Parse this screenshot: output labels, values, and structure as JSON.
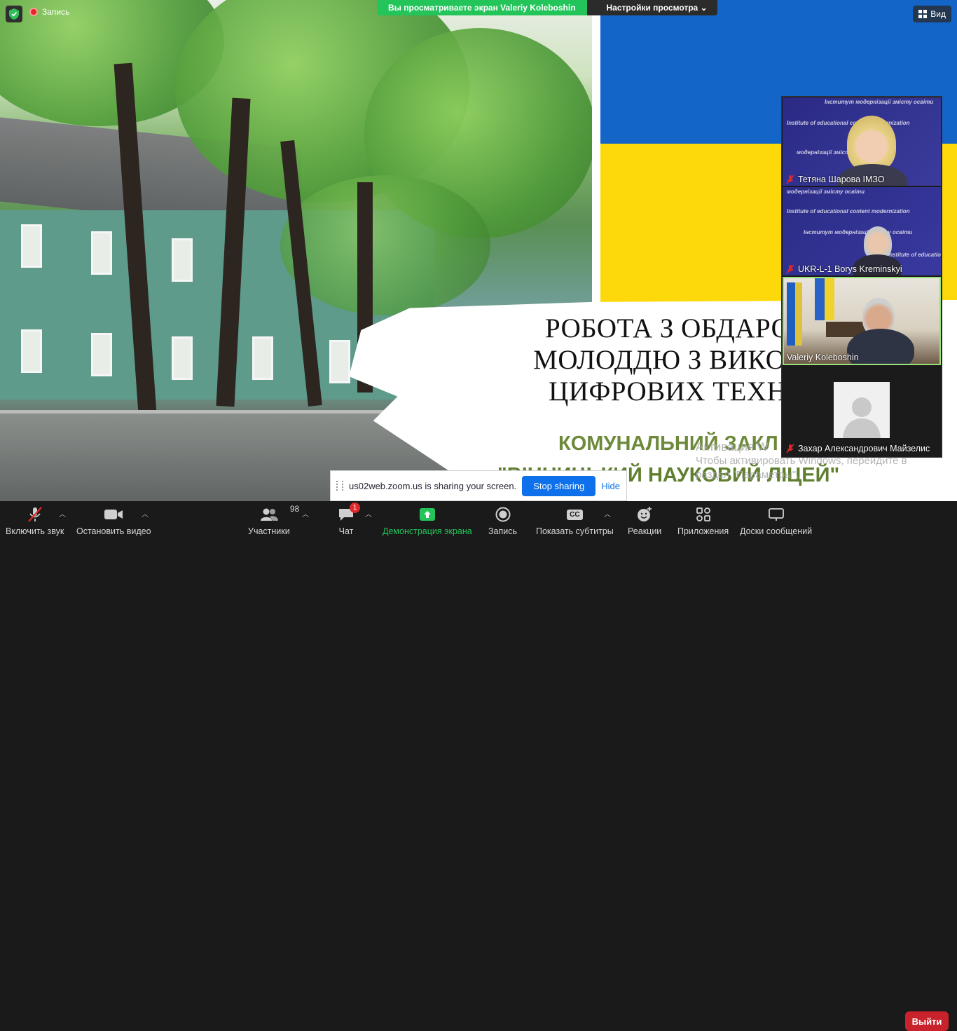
{
  "top_bar": {
    "recording_label": "Запись",
    "share_banner_text": "Вы просматриваете экран Valeriy Koleboshin",
    "view_options_label": "Настройки просмотра",
    "view_label": "Вид"
  },
  "slide": {
    "title_lines": "РОБОТА З ОБДАРОВА\nМОЛОДДЮ З ВИКОРИС\nЦИФРОВИХ ТЕХНОЛ",
    "subtitle_line1": "КОМУНАЛЬНИЙ ЗАКЛ",
    "subtitle_line2": "\"ВІННИЦЬКИЙ НАУКОВИЙ ЛІЦЕЙ\"",
    "windows_watermark_line1": "Активация W",
    "windows_watermark_line2": "Чтобы активировать Windows, перейдите в",
    "windows_watermark_line3": "раздел \"Параметры\"."
  },
  "participants": [
    {
      "name": "Тетяна Шарова ІМЗО",
      "muted": true
    },
    {
      "name": "UKR-L-1 Borys Kreminskyi",
      "muted": true
    },
    {
      "name": "Valeriy Koleboshin",
      "muted": false
    },
    {
      "name": "Захар Александрович Майзелис",
      "muted": true
    }
  ],
  "virtual_background_text": {
    "a": "Інститут модернізації змісту освіти",
    "b": "Institute of educational content modernization",
    "c": "модернізації змісту освіти",
    "d": "Institute of education"
  },
  "sharing_toast": {
    "message": "us02web.zoom.us is sharing your screen.",
    "stop_label": "Stop sharing",
    "hide_label": "Hide"
  },
  "toolbar": {
    "unmute_label": "Включить звук",
    "video_label": "Остановить видео",
    "participants_label": "Участники",
    "participants_count": "98",
    "chat_label": "Чат",
    "chat_badge": "1",
    "share_label": "Демонстрация экрана",
    "record_label": "Запись",
    "captions_label": "Показать субтитры",
    "captions_icon_text": "CC",
    "reactions_label": "Реакции",
    "apps_label": "Приложения",
    "whiteboard_label": "Доски сообщений",
    "leave_label": "Выйти"
  },
  "colors": {
    "share_green": "#23c55a",
    "leave_red": "#c8232c",
    "stop_blue": "#0e71eb",
    "flag_blue": "#1465c8",
    "flag_yellow": "#fdd90b"
  }
}
